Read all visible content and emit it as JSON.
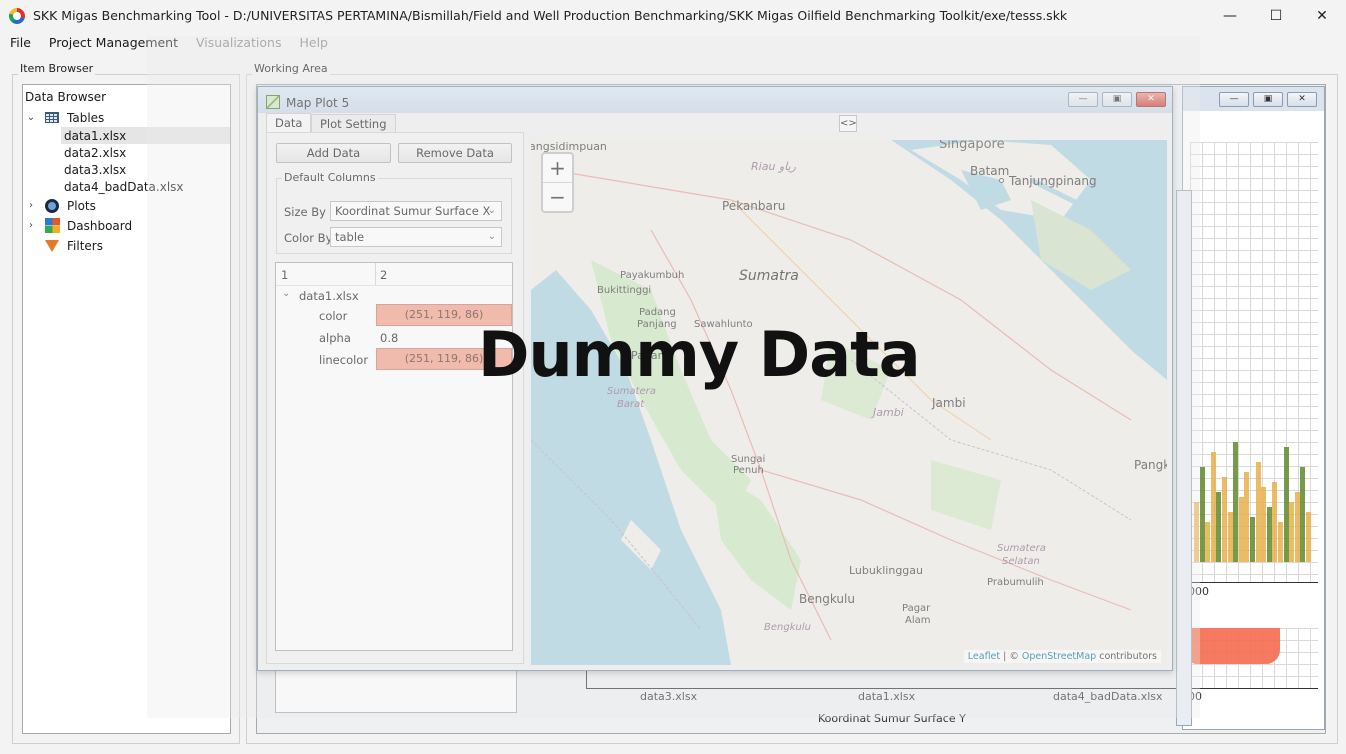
{
  "window": {
    "title": "SKK Migas Benchmarking Tool - D:/UNIVERSITAS PERTAMINA/Bismillah/Field and Well Production Benchmarking/SKK Migas Oilfield Benchmarking Toolkit/exe/tesss.skk",
    "minimize": "—",
    "maximize": "☐",
    "close": "✕"
  },
  "menu": [
    "File",
    "Project Management",
    "Visualizations",
    "Help"
  ],
  "item_browser": {
    "label": "Item Browser",
    "header": "Data Browser",
    "tables_label": "Tables",
    "tables": [
      "data1.xlsx",
      "data2.xlsx",
      "data3.xlsx",
      "data4_badData.xlsx"
    ],
    "plots_label": "Plots",
    "dashboard_label": "Dashboard",
    "filters_label": "Filters"
  },
  "working_area": {
    "label": "Working Area",
    "bg_chart": {
      "tick_value_1": "000",
      "tick_value_2": "00",
      "x_categories": [
        "data3.xlsx",
        "data1.xlsx",
        "data4_badData.xlsx"
      ],
      "x_label": "Koordinat Sumur Surface Y",
      "bar_colors": [
        "#e8b04a",
        "#5f8a2a"
      ]
    }
  },
  "map_window": {
    "title": "Map Plot 5",
    "tabs": [
      "Data",
      "Plot Setting"
    ],
    "toggle": "<>",
    "add_data": "Add Data",
    "remove_data": "Remove Data",
    "default_columns_label": "Default Columns",
    "size_by_label": "Size By",
    "size_by_value": "Koordinat Sumur Surface X",
    "color_by_label": "Color By",
    "color_by_value": "table",
    "table": {
      "header_col1": "1",
      "header_col2": "2",
      "group": "data1.xlsx",
      "rows": [
        {
          "key": "color",
          "value": "(251, 119, 86)"
        },
        {
          "key": "alpha",
          "value": "0.8"
        },
        {
          "key": "linecolor",
          "value": "(251, 119, 86)"
        }
      ],
      "swatch_color": "#fb7756"
    },
    "map": {
      "zoom_in": "+",
      "zoom_out": "−",
      "labels": {
        "singapore": "Singapore",
        "batam": "Batam",
        "tanjungpinang": "Tanjungpinang",
        "riau": "Riau رياو",
        "pekanbaru": "Pekanbaru",
        "sumatra": "Sumatra",
        "payakumbuh": "Payakumbuh",
        "bukittinggi": "Bukittinggi",
        "padang_panjang_1": "Padang",
        "padang_panjang_2": "Panjang",
        "sawahlunto": "Sawahlunto",
        "padang": "Padang",
        "sumbar_1": "Sumatera",
        "sumbar_2": "Barat",
        "jambi_prov": "Jambi",
        "jambi": "Jambi",
        "sungai_penuh_1": "Sungai",
        "sungai_penuh_2": "Penuh",
        "pangk": "Pangk",
        "sumsel_1": "Sumatera",
        "sumsel_2": "Selatan",
        "lubuklinggau": "Lubuklinggau",
        "prabumulih": "Prabumulih",
        "bengkulu": "Bengkulu",
        "bengkulu_prov": "Bengkulu",
        "pagar_alam_1": "Pagar",
        "pagar_alam_2": "Alam",
        "sidimpuan": "angsidimpuan"
      },
      "attribution_leaflet": "Leaflet",
      "attribution_sep": " | © ",
      "attribution_osm": "OpenStreetMap",
      "attribution_tail": " contributors"
    }
  },
  "watermark": "Dummy Data"
}
